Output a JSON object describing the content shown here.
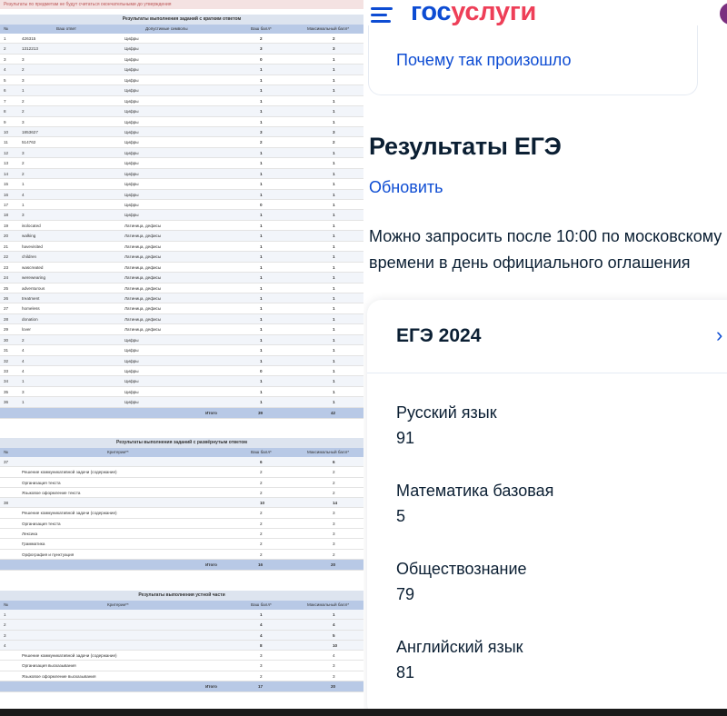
{
  "left": {
    "warning": "Результаты по предметам не будут считаться окончательными до утверждения",
    "short_section": {
      "title": "Результаты выполнения заданий с кратким ответом",
      "headers": [
        "№",
        "Ваш ответ",
        "Допустимые символы",
        "Ваш балл*",
        "Максимальный балл*"
      ],
      "rows": [
        [
          "1",
          "426315",
          "Цифры",
          "2",
          "2"
        ],
        [
          "2",
          "1312213",
          "Цифры",
          "3",
          "3"
        ],
        [
          "3",
          "3",
          "Цифры",
          "0",
          "1"
        ],
        [
          "4",
          "2",
          "Цифры",
          "1",
          "1"
        ],
        [
          "5",
          "3",
          "Цифры",
          "1",
          "1"
        ],
        [
          "6",
          "1",
          "Цифры",
          "1",
          "1"
        ],
        [
          "7",
          "2",
          "Цифры",
          "1",
          "1"
        ],
        [
          "8",
          "2",
          "Цифры",
          "1",
          "1"
        ],
        [
          "9",
          "3",
          "Цифры",
          "1",
          "1"
        ],
        [
          "10",
          "1853627",
          "Цифры",
          "3",
          "3"
        ],
        [
          "11",
          "514762",
          "Цифры",
          "2",
          "2"
        ],
        [
          "12",
          "3",
          "Цифры",
          "1",
          "1"
        ],
        [
          "13",
          "2",
          "Цифры",
          "1",
          "1"
        ],
        [
          "14",
          "2",
          "Цифры",
          "1",
          "1"
        ],
        [
          "15",
          "1",
          "Цифры",
          "1",
          "1"
        ],
        [
          "16",
          "4",
          "Цифры",
          "1",
          "1"
        ],
        [
          "17",
          "1",
          "Цифры",
          "0",
          "1"
        ],
        [
          "18",
          "3",
          "Цифры",
          "1",
          "1"
        ],
        [
          "19",
          "isolocated",
          "Латиница, дефисы",
          "1",
          "1"
        ],
        [
          "20",
          "walking",
          "Латиница, дефисы",
          "1",
          "1"
        ],
        [
          "21",
          "havevisited",
          "Латиница, дефисы",
          "1",
          "1"
        ],
        [
          "22",
          "children",
          "Латиница, дефисы",
          "1",
          "1"
        ],
        [
          "23",
          "wascreated",
          "Латиница, дефисы",
          "1",
          "1"
        ],
        [
          "24",
          "werewearing",
          "Латиница, дефисы",
          "1",
          "1"
        ],
        [
          "25",
          "adventurous",
          "Латиница, дефисы",
          "1",
          "1"
        ],
        [
          "26",
          "treatment",
          "Латиница, дефисы",
          "1",
          "1"
        ],
        [
          "27",
          "homeless",
          "Латиница, дефисы",
          "1",
          "1"
        ],
        [
          "28",
          "donation",
          "Латиница, дефисы",
          "1",
          "1"
        ],
        [
          "29",
          "lover",
          "Латиница, дефисы",
          "1",
          "1"
        ],
        [
          "30",
          "2",
          "Цифры",
          "1",
          "1"
        ],
        [
          "31",
          "4",
          "Цифры",
          "1",
          "1"
        ],
        [
          "32",
          "4",
          "Цифры",
          "1",
          "1"
        ],
        [
          "33",
          "4",
          "Цифры",
          "0",
          "1"
        ],
        [
          "34",
          "1",
          "Цифры",
          "1",
          "1"
        ],
        [
          "35",
          "3",
          "Цифры",
          "1",
          "1"
        ],
        [
          "36",
          "1",
          "Цифры",
          "1",
          "1"
        ]
      ],
      "total": [
        "Итого",
        "39",
        "42"
      ]
    },
    "long_section": {
      "title": "Результаты выполнения заданий с развёрнутым ответом",
      "headers": [
        "№",
        "Критерии**",
        "Ваш балл*",
        "Максимальный балл*"
      ],
      "rows": [
        [
          "37",
          "",
          "6",
          "6",
          "main"
        ],
        [
          "",
          "Решение коммуникативной задачи (содержание)",
          "2",
          "2",
          "crit"
        ],
        [
          "",
          "Организация текста",
          "2",
          "2",
          "crit"
        ],
        [
          "",
          "Языковое оформление текста",
          "2",
          "2",
          "crit"
        ],
        [
          "38",
          "",
          "10",
          "14",
          "main"
        ],
        [
          "",
          "Решение коммуникативной задачи (содержание)",
          "2",
          "3",
          "crit"
        ],
        [
          "",
          "Организация текста",
          "2",
          "3",
          "crit"
        ],
        [
          "",
          "Лексика",
          "2",
          "3",
          "crit"
        ],
        [
          "",
          "Грамматика",
          "2",
          "3",
          "crit"
        ],
        [
          "",
          "Орфография и пунктуация",
          "2",
          "2",
          "crit"
        ]
      ],
      "total": [
        "Итого",
        "16",
        "20"
      ]
    },
    "oral_section": {
      "title": "Результаты выполнения устной части",
      "headers": [
        "№",
        "Критерии**",
        "Ваш балл*",
        "Максимальный балл*"
      ],
      "rows": [
        [
          "1",
          "",
          "1",
          "1",
          "main"
        ],
        [
          "2",
          "",
          "4",
          "4",
          "main"
        ],
        [
          "3",
          "",
          "4",
          "5",
          "main"
        ],
        [
          "4",
          "",
          "8",
          "10",
          "main"
        ],
        [
          "",
          "Решение коммуникативной задачи (содержание)",
          "3",
          "4",
          "crit"
        ],
        [
          "",
          "Организация высказывания",
          "3",
          "3",
          "crit"
        ],
        [
          "",
          "Языковое оформление высказывания",
          "2",
          "3",
          "crit"
        ]
      ],
      "total": [
        "Итого",
        "17",
        "20"
      ]
    }
  },
  "right": {
    "logo_part1": "гос",
    "logo_part2": "услуги",
    "why_link": "Почему так произошло",
    "page_title": "Результаты ЕГЭ",
    "refresh_link": "Обновить",
    "note": "Можно запросить после 10:00 по московскому времени в день официального оглашения",
    "exam_title": "ЕГЭ 2024",
    "chevron": "›",
    "subjects": [
      {
        "name": "Русский язык",
        "score": "91"
      },
      {
        "name": "Математика базовая",
        "score": "5"
      },
      {
        "name": "Обществознание",
        "score": "79"
      },
      {
        "name": "Английский язык",
        "score": "81"
      }
    ],
    "colors": {
      "brand_blue": "#0d4cd3",
      "brand_red": "#ee3f58",
      "text": "#0b1f33"
    }
  }
}
